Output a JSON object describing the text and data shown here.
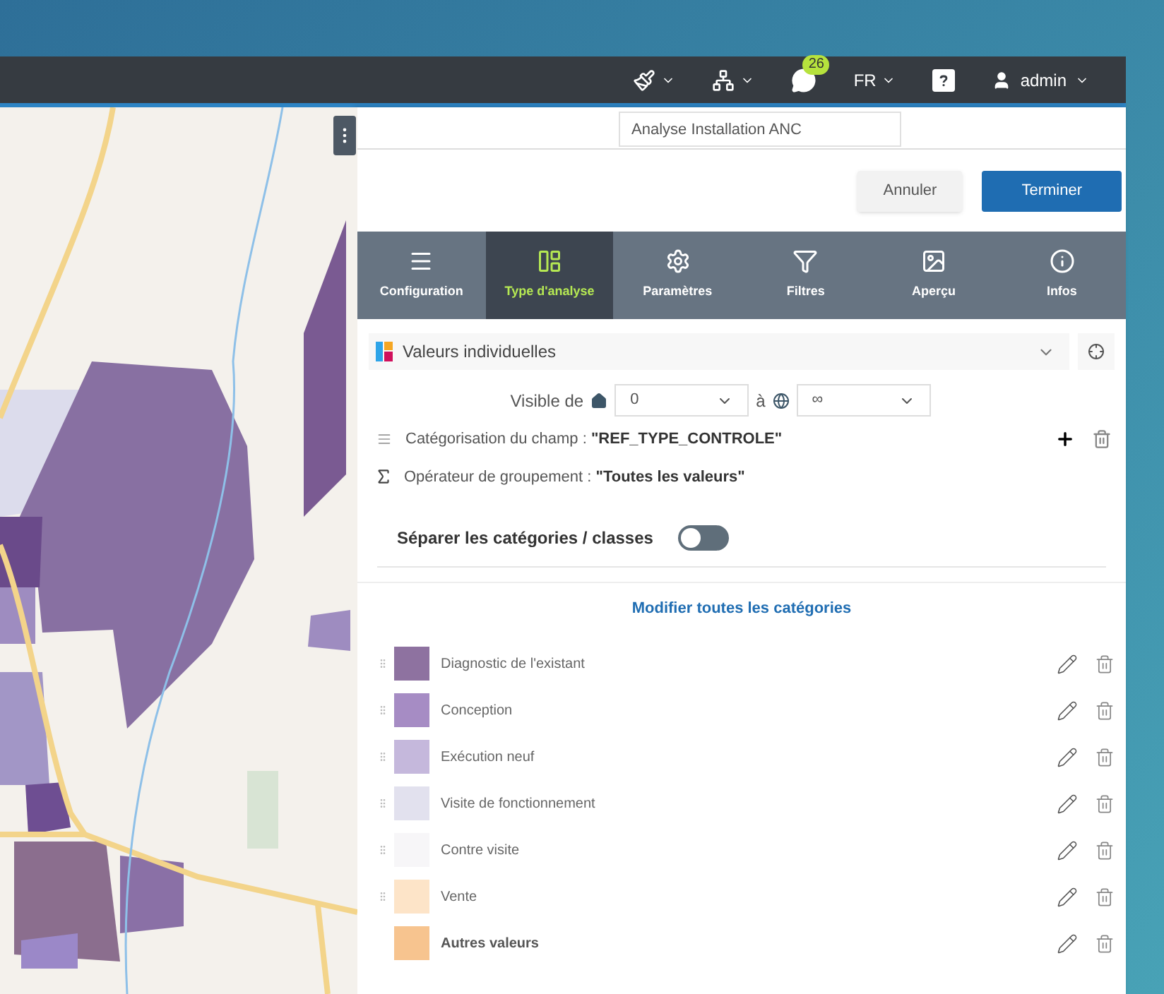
{
  "topbar": {
    "language": "FR",
    "notification_count": "26",
    "user": "admin"
  },
  "analysis_name": {
    "value": "Analyse Installation ANC"
  },
  "buttons": [
    {
      "label": "Annuler",
      "kind": "secondary"
    },
    {
      "label": "Terminer",
      "kind": "primary"
    }
  ],
  "tabs": [
    {
      "label": "Configuration",
      "kind": "lines",
      "selected": false
    },
    {
      "label": "Type d'analyse",
      "kind": "layout",
      "selected": true
    },
    {
      "label": "Paramètres",
      "kind": "gear",
      "selected": false
    },
    {
      "label": "Filtres",
      "kind": "filter",
      "selected": false
    },
    {
      "label": "Aperçu",
      "kind": "image",
      "selected": false
    },
    {
      "label": "Infos",
      "kind": "info",
      "selected": false
    }
  ],
  "analysis_type": {
    "value": "Valeurs individuelles"
  },
  "visibility": {
    "label": "Visible de",
    "from": "0",
    "to_label": "à",
    "to": "∞"
  },
  "field_categorization": {
    "label": "Catégorisation du champ : ",
    "value": "\"REF_TYPE_CONTROLE\""
  },
  "grouping_operator": {
    "label": "Opérateur de groupement : ",
    "value": "\"Toutes les valeurs\""
  },
  "separate_toggle": {
    "label": "Séparer les catégories / classes",
    "on": false
  },
  "edit_all_link": "Modifier toutes les catégories",
  "categories": [
    {
      "label": "Diagnostic de l'existant",
      "color": "#8e72a0",
      "kind": "value"
    },
    {
      "label": "Conception",
      "color": "#a68cc4",
      "kind": "value"
    },
    {
      "label": "Exécution neuf",
      "color": "#c5b8dc",
      "kind": "value"
    },
    {
      "label": "Visite de fonctionnement",
      "color": "#e2e1ee",
      "kind": "value"
    },
    {
      "label": "Contre visite",
      "color": "#f7f6f8",
      "kind": "value"
    },
    {
      "label": "Vente",
      "color": "#fde4c8",
      "kind": "value"
    },
    {
      "label": "Autres valeurs",
      "color": "#f7c48f",
      "kind": "other"
    }
  ]
}
